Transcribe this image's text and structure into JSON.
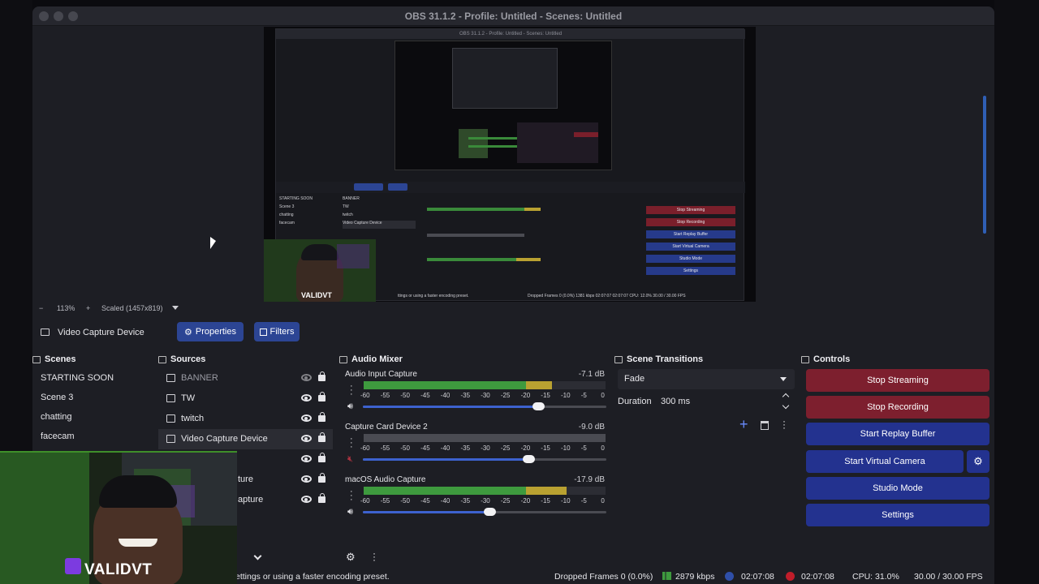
{
  "window": {
    "title": "OBS 31.1.2 - Profile: Untitled - Scenes: Untitled"
  },
  "preview": {
    "nested_title": "OBS 31.1.2 - Profile: Untitled - Scenes: Untitled",
    "nested_status": "ttings or using a faster encoding preset.",
    "nested_stats": "Dropped Frames 0 (0.0%)   1381 kbps   02:07:07   02:07:07   CPU: 12.0%   30.00 / 30.00 FPS",
    "cam_label": "VALIDVT",
    "nested_scenes": [
      "STARTING SOON",
      "Scene 3",
      "chatting",
      "facecam"
    ],
    "nested_sources": [
      "BANNER",
      "TW",
      "twitch",
      "Video Capture Device"
    ],
    "nested_controls": [
      "Stop Streaming",
      "Stop Recording",
      "Start Replay Buffer",
      "Start Virtual Camera",
      "Studio Mode",
      "Settings"
    ]
  },
  "zoom": {
    "minus": "−",
    "level": "113%",
    "plus": "+",
    "scale": "Scaled (1457x819)",
    "dropdown_icon": "caret-down-icon"
  },
  "source_toolbar": {
    "selected_source": "Video Capture Device",
    "properties_label": "Properties",
    "filters_label": "Filters"
  },
  "scenes": {
    "title": "Scenes",
    "items": [
      {
        "label": "STARTING SOON"
      },
      {
        "label": "Scene 3"
      },
      {
        "label": "chatting"
      },
      {
        "label": "facecam"
      }
    ]
  },
  "sources": {
    "title": "Sources",
    "items": [
      {
        "label": "BANNER",
        "visible": false
      },
      {
        "label": "TW",
        "visible": true
      },
      {
        "label": "twitch",
        "visible": true
      },
      {
        "label": "Video Capture Device",
        "visible": true
      },
      {
        "label": "",
        "visible": true
      },
      {
        "label": "ture",
        "visible": true
      },
      {
        "label": "apture",
        "visible": true
      }
    ]
  },
  "mixer": {
    "title": "Audio Mixer",
    "ticks": [
      "-60",
      "-55",
      "-50",
      "-45",
      "-40",
      "-35",
      "-30",
      "-25",
      "-20",
      "-15",
      "-10",
      "-5",
      "0"
    ],
    "channels": [
      {
        "name": "Audio Input Capture",
        "db": "-7.1 dB",
        "level": 0.78,
        "volume": 0.72,
        "muted": false
      },
      {
        "name": "Capture Card Device 2",
        "db": "-9.0 dB",
        "level": 0.0,
        "volume": 0.68,
        "muted": true
      },
      {
        "name": "macOS Audio Capture",
        "db": "-17.9 dB",
        "level": 0.84,
        "volume": 0.52,
        "muted": false
      }
    ]
  },
  "transitions": {
    "title": "Scene Transitions",
    "selected": "Fade",
    "duration_label": "Duration",
    "duration_value": "300 ms"
  },
  "controls": {
    "title": "Controls",
    "stop_streaming": "Stop Streaming",
    "stop_recording": "Stop Recording",
    "start_replay": "Start Replay Buffer",
    "start_virtual_camera": "Start Virtual Camera",
    "studio_mode": "Studio Mode",
    "settings": "Settings"
  },
  "status": {
    "message": "ettings or using a faster encoding preset.",
    "dropped_frames": "Dropped Frames 0 (0.0%)",
    "bitrate": "2879 kbps",
    "stream_time": "02:07:08",
    "record_time": "02:07:08",
    "cpu": "CPU: 31.0%",
    "fps": "30.00 / 30.00 FPS"
  },
  "overlay": {
    "cam_name": "VALIDVT"
  },
  "colors": {
    "accent_blue": "#2c4594",
    "stop_red": "#7d1f2e",
    "meter_green": "#3e9a3e",
    "meter_yellow": "#b9a131",
    "meter_red": "#b03340"
  }
}
